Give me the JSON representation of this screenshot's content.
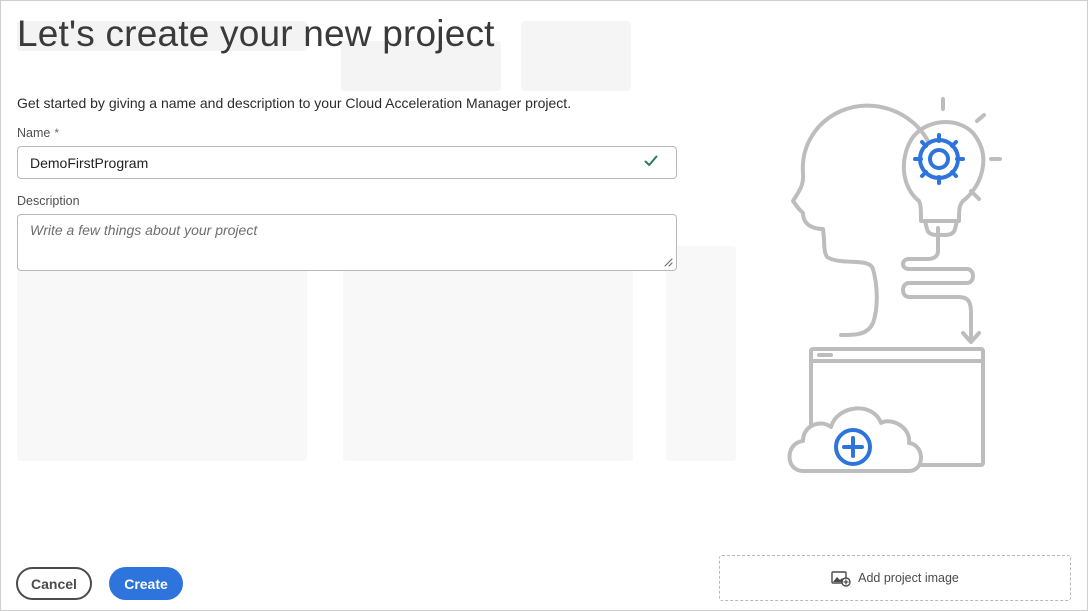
{
  "page": {
    "title": "Let's create your new project",
    "subtitle": "Get started by giving a name and description to your Cloud Acceleration Manager project."
  },
  "form": {
    "name_label": "Name",
    "name_required_marker": "*",
    "name_value": "DemoFirstProgram",
    "name_valid": true,
    "description_label": "Description",
    "description_placeholder": "Write a few things about your project",
    "description_value": ""
  },
  "actions": {
    "cancel_label": "Cancel",
    "create_label": "Create",
    "add_image_label": "Add project image"
  },
  "icons": {
    "name_valid": "checkmark-icon",
    "add_image": "image-add-icon",
    "illustration": "head-lightbulb-cloud-illustration"
  },
  "colors": {
    "accent": "#2d74dd",
    "valid": "#2d7a5f",
    "illustration_line": "#bdbdbd",
    "illustration_accent": "#2d74dd"
  }
}
